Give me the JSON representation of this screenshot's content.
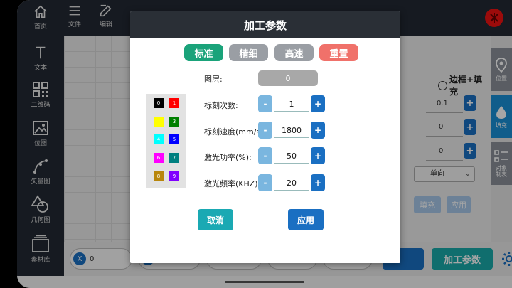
{
  "sidebar": {
    "items": [
      {
        "label": "首页",
        "icon": "home-icon"
      },
      {
        "label": "文本",
        "icon": "text-icon"
      },
      {
        "label": "二维码",
        "icon": "qrcode-icon"
      },
      {
        "label": "位图",
        "icon": "image-icon"
      },
      {
        "label": "矢量图",
        "icon": "vector-icon"
      },
      {
        "label": "几何图",
        "icon": "shapes-icon"
      },
      {
        "label": "素材库",
        "icon": "library-icon"
      }
    ]
  },
  "toolbar": {
    "items": [
      {
        "label": "文件",
        "icon": "menu-icon"
      },
      {
        "label": "编辑",
        "icon": "edit-icon"
      }
    ]
  },
  "right_panel": {
    "fill_option": "边框+填充",
    "row1_value": "0.1",
    "row2_value": "0",
    "row3_value": "0",
    "select_value": "单向",
    "btn_partial": "填充",
    "btn_apply": "应用"
  },
  "right_icons": [
    {
      "label": "位置",
      "icon": "location-icon"
    },
    {
      "label": "填充",
      "icon": "fill-drop-icon"
    },
    {
      "label": "对象\n制表",
      "icon": "object-list-icon"
    }
  ],
  "bottom": {
    "coord_x_badge": "X",
    "coord_x_value": "0",
    "coord_y_badge": "Y",
    "process_button": "加工参数"
  },
  "dialog": {
    "title": "加工参数",
    "presets": [
      {
        "label": "标准",
        "color": "#1aa37a"
      },
      {
        "label": "精细",
        "color": "#9a9ea4"
      },
      {
        "label": "高速",
        "color": "#9a9ea4"
      },
      {
        "label": "重置",
        "color": "#f0716a"
      }
    ],
    "palette": [
      {
        "label": "0",
        "color": "#000000",
        "text": "#ffffff"
      },
      {
        "label": "1",
        "color": "#ff0000",
        "text": "#ffffff"
      },
      {
        "label": "2",
        "color": "#ffff00",
        "text": "#ffff00"
      },
      {
        "label": "3",
        "color": "#008000",
        "text": "#ffffff"
      },
      {
        "label": "4",
        "color": "#00ffff",
        "text": "#ffffff"
      },
      {
        "label": "5",
        "color": "#0000ff",
        "text": "#ffffff"
      },
      {
        "label": "6",
        "color": "#ff00ff",
        "text": "#ffffff"
      },
      {
        "label": "7",
        "color": "#008080",
        "text": "#ffffff"
      },
      {
        "label": "8",
        "color": "#b8860b",
        "text": "#ffffff"
      },
      {
        "label": "9",
        "color": "#8000ff",
        "text": "#ffffff"
      }
    ],
    "layer_label": "图层:",
    "layer_value": "0",
    "fields": [
      {
        "label": "标刻次数:",
        "value": "1"
      },
      {
        "label": "标刻速度(mm/s):",
        "value": "1800"
      },
      {
        "label": "激光功率(%):",
        "value": "50"
      },
      {
        "label": "激光频率(KHZ):",
        "value": "20"
      }
    ],
    "minus": "-",
    "plus": "+",
    "cancel": "取消",
    "apply": "应用"
  }
}
